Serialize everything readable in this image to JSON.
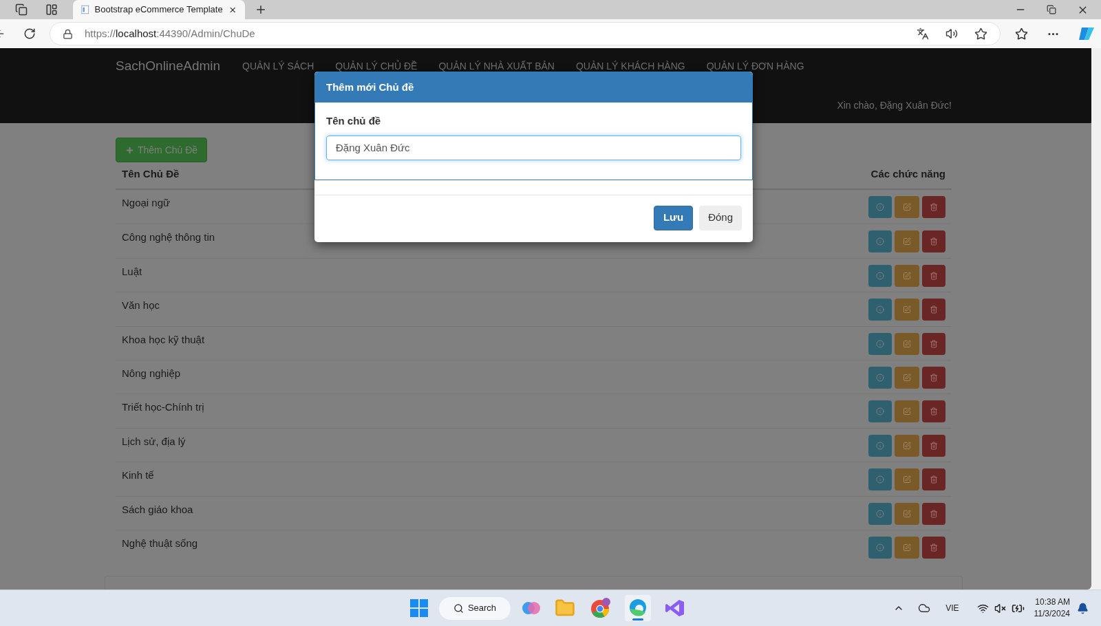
{
  "browser": {
    "tab_title": "Bootstrap eCommerce Template",
    "url_prefix": "https://",
    "url_host": "localhost",
    "url_rest": ":44390/Admin/ChuDe"
  },
  "navbar": {
    "brand": "SachOnlineAdmin",
    "items": [
      {
        "label": "QUẢN LÝ SÁCH"
      },
      {
        "label": "QUẢN LÝ CHỦ ĐỀ"
      },
      {
        "label": "QUẢN LÝ NHÀ XUẤT BẢN"
      },
      {
        "label": "QUẢN LÝ KHÁCH HÀNG"
      },
      {
        "label": "QUẢN LÝ ĐƠN HÀNG"
      }
    ],
    "greeting": "Xin chào, Đặng Xuân Đức!"
  },
  "add_button": "Thêm Chủ Đề",
  "table": {
    "columns": [
      "Tên Chủ Đề",
      "Các chức năng"
    ],
    "rows": [
      {
        "name": "Ngoại ngữ"
      },
      {
        "name": "Công nghệ thông tin"
      },
      {
        "name": "Luật"
      },
      {
        "name": "Văn học"
      },
      {
        "name": "Khoa học kỹ thuật"
      },
      {
        "name": "Nông nghiệp"
      },
      {
        "name": "Triết học-Chính trị"
      },
      {
        "name": "Lịch sử, địa lý"
      },
      {
        "name": "Kinh tế"
      },
      {
        "name": "Sách giáo khoa"
      },
      {
        "name": "Nghệ thuật sống"
      }
    ]
  },
  "modal": {
    "title": "Thêm mới Chủ đề",
    "label": "Tên chủ đề",
    "value": "Đặng Xuân Đức",
    "save": "Lưu",
    "close": "Đóng"
  },
  "taskbar": {
    "search": "Search",
    "language": "VIE",
    "time": "10:38 AM",
    "date": "11/3/2024"
  }
}
